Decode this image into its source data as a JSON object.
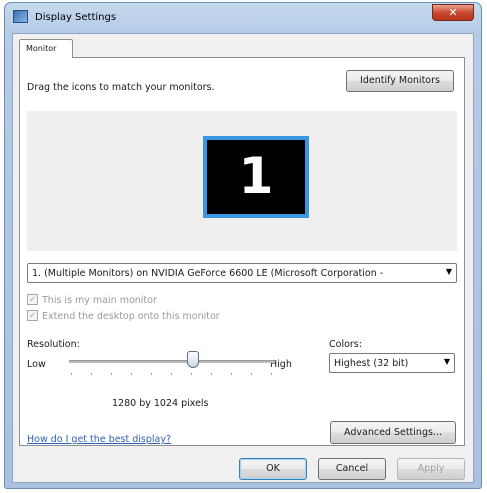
{
  "window": {
    "title": "Display Settings"
  },
  "tabs": [
    {
      "label": "Monitor"
    }
  ],
  "monitor_tab": {
    "instruction": "Drag the icons to match your monitors.",
    "identify_button": "Identify Monitors",
    "monitor_number": "1",
    "monitor_select": "1. (Multiple Monitors) on NVIDIA GeForce 6600 LE (Microsoft Corporation -",
    "main_monitor_checkbox": {
      "label": "This is my main monitor",
      "checked": true,
      "enabled": false
    },
    "extend_desktop_checkbox": {
      "label": "Extend the desktop onto this monitor",
      "checked": true,
      "enabled": false
    },
    "resolution": {
      "label": "Resolution:",
      "low_label": "Low",
      "high_label": "High",
      "value_text": "1280 by 1024 pixels"
    },
    "colors": {
      "label": "Colors:",
      "selected": "Highest (32 bit)"
    },
    "help_link": "How do I get the best display?",
    "advanced_button": "Advanced Settings..."
  },
  "footer": {
    "ok": "OK",
    "cancel": "Cancel",
    "apply": "Apply"
  },
  "colors_theme": {
    "monitor_highlight": "#3b95e3",
    "link": "#2f5fb0",
    "close_button": "#c8452c"
  }
}
